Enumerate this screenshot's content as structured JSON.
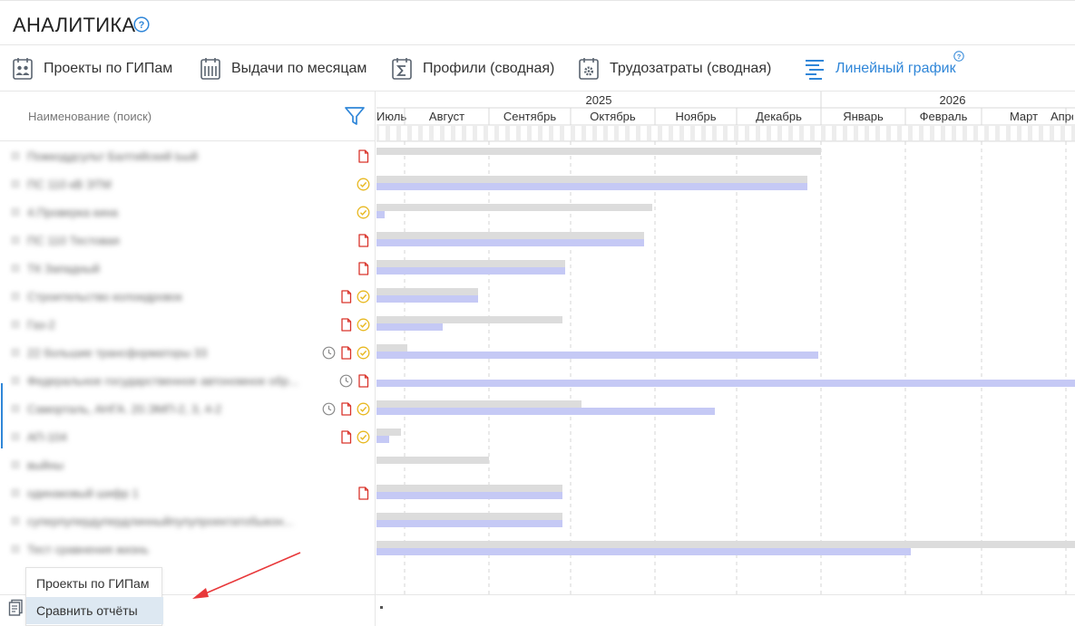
{
  "header": {
    "title": "АНАЛИТИКА"
  },
  "tabs": [
    {
      "label": "Проекты по ГИПам",
      "icon": "team-board-icon",
      "active": false
    },
    {
      "label": "Выдачи по месяцам",
      "icon": "calendar-grid-icon",
      "active": false
    },
    {
      "label": "Профили (сводная)",
      "icon": "calendar-sigma-icon",
      "active": false
    },
    {
      "label": "Трудозатраты (сводная)",
      "icon": "calendar-gear-icon",
      "active": false
    },
    {
      "label": "Линейный график",
      "icon": "gantt-lines-icon",
      "active": true
    }
  ],
  "list": {
    "column_header": "Наименование (поиск)",
    "rows": [
      {
        "name": "Пожкоддсульт Балтийский Ьый",
        "icons": [
          "doc-icon"
        ]
      },
      {
        "name": "ПС 110 кВ ЭТМ",
        "icons": [
          "check-circle-icon"
        ]
      },
      {
        "name": "4.Проверка кина",
        "icons": [
          "check-circle-icon"
        ]
      },
      {
        "name": "ПС 110 Тестовая",
        "icons": [
          "doc-icon"
        ]
      },
      {
        "name": "ТК Западный",
        "icons": [
          "doc-icon"
        ]
      },
      {
        "name": "Строительство колоидровок",
        "icons": [
          "doc-icon",
          "check-circle-icon"
        ]
      },
      {
        "name": "Газ-2",
        "icons": [
          "doc-icon",
          "check-circle-icon"
        ]
      },
      {
        "name": "22 большие трансформаторы 33",
        "icons": [
          "clock-icon",
          "doc-icon",
          "check-circle-icon"
        ]
      },
      {
        "name": "Федеральное государственное автономное обр...",
        "icons": [
          "clock-icon",
          "doc-icon"
        ]
      },
      {
        "name": "Саморталь, АНГА. 20.ЭМП-2, 3, 4-2",
        "icons": [
          "clock-icon",
          "doc-icon",
          "check-circle-icon"
        ]
      },
      {
        "name": "АП-104",
        "icons": [
          "doc-icon",
          "check-circle-icon"
        ]
      },
      {
        "name": "выйны",
        "icons": []
      },
      {
        "name": "одинаковый шифр 1",
        "icons": [
          "doc-icon"
        ]
      },
      {
        "name": "суперпупердупердлинныйпупупроектатобыкон...",
        "icons": []
      },
      {
        "name": "Тест сравнения жизнь",
        "icons": []
      }
    ]
  },
  "timeline": {
    "years": [
      "2025",
      "2026"
    ],
    "months": [
      "Июль",
      "Август",
      "Сентябрь",
      "Октябрь",
      "Ноябрь",
      "Декабрь",
      "Январь",
      "Февраль",
      "Март",
      "Апрель"
    ],
    "rows": [
      {
        "plan": [
          "2025-07-01",
          "2026-01-01"
        ],
        "fact": null
      },
      {
        "plan": [
          "2025-07-01",
          "2025-12-27"
        ],
        "fact": [
          "2025-07-01",
          "2025-12-27"
        ]
      },
      {
        "plan": [
          "2025-07-01",
          "2025-10-31"
        ],
        "fact": [
          "2025-07-01",
          "2025-07-10"
        ]
      },
      {
        "plan": [
          "2025-07-01",
          "2025-10-28"
        ],
        "fact": [
          "2025-07-01",
          "2025-10-28"
        ]
      },
      {
        "plan": [
          "2025-07-01",
          "2025-09-29"
        ],
        "fact": [
          "2025-07-01",
          "2025-09-29"
        ]
      },
      {
        "plan": [
          "2025-07-01",
          "2025-08-28"
        ],
        "fact": [
          "2025-07-01",
          "2025-08-28"
        ]
      },
      {
        "plan": [
          "2025-07-01",
          "2025-09-28"
        ],
        "fact": [
          "2025-07-01",
          "2025-08-15"
        ]
      },
      {
        "plan": [
          "2025-07-01",
          "2025-08-02"
        ],
        "fact": [
          "2025-07-01",
          "2025-12-31"
        ]
      },
      {
        "plan": null,
        "fact": [
          "2025-07-01",
          "2026-04-15"
        ]
      },
      {
        "plan": [
          "2025-07-01",
          "2025-10-05"
        ],
        "fact": [
          "2025-07-01",
          "2025-11-23"
        ]
      },
      {
        "plan": [
          "2025-07-01",
          "2025-07-28"
        ],
        "fact": [
          "2025-07-01",
          "2025-07-15"
        ]
      },
      {
        "plan": [
          "2025-07-01",
          "2025-09-01"
        ],
        "fact": null
      },
      {
        "plan": [
          "2025-07-01",
          "2025-09-28"
        ],
        "fact": [
          "2025-07-01",
          "2025-09-28"
        ]
      },
      {
        "plan": [
          "2025-07-01",
          "2025-09-28"
        ],
        "fact": [
          "2025-07-01",
          "2025-09-28"
        ]
      },
      {
        "plan": [
          "2025-07-01",
          "2026-04-15"
        ],
        "fact": [
          "2025-07-01",
          "2026-02-03"
        ]
      }
    ]
  },
  "popup_menu": {
    "items": [
      "Проекты по ГИПам",
      "Сравнить отчёты"
    ],
    "highlighted": "Сравнить отчёты"
  },
  "colors": {
    "accent": "#2f86d8",
    "plan_bar": "#dcdcdc",
    "fact_bar": "#c5c9f5",
    "doc_icon": "#d9342b",
    "check_icon": "#e8b820",
    "annotation_arrow": "#e8383a"
  }
}
